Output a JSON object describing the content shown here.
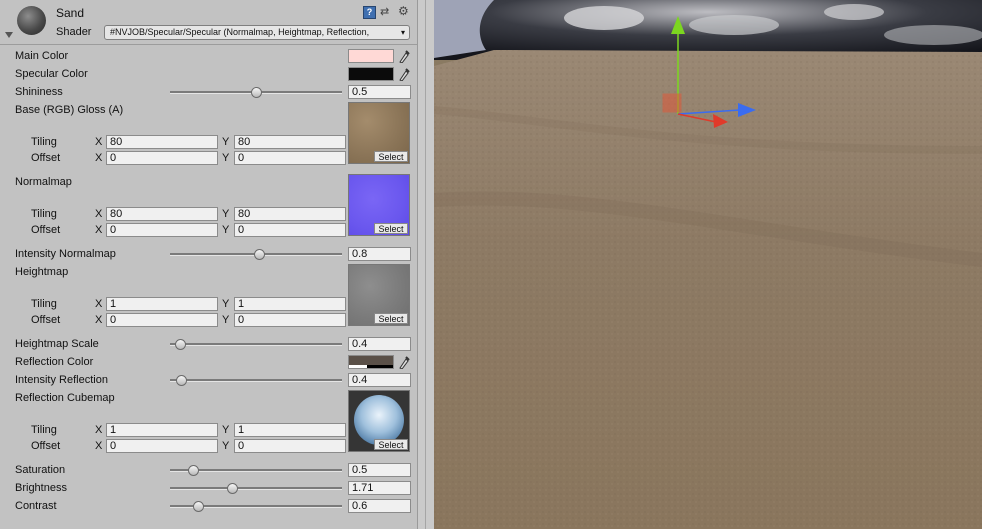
{
  "header": {
    "material_name": "Sand",
    "shader_label": "Shader",
    "shader_value": "#NVJOB/Specular/Specular (Normalmap, Heightmap, Reflection,"
  },
  "colors": {
    "main": "#ffd9d6",
    "specular": "#0b0b0b",
    "reflection": "#5a5048"
  },
  "props": {
    "main_color": "Main Color",
    "specular_color": "Specular Color",
    "shininess": {
      "label": "Shininess",
      "value": "0.5",
      "level": 0.5
    },
    "base": {
      "label": "Base (RGB) Gloss (A)",
      "tiling_x": "80",
      "tiling_y": "80",
      "offset_x": "0",
      "offset_y": "0"
    },
    "normalmap": {
      "label": "Normalmap",
      "tiling_x": "80",
      "tiling_y": "80",
      "offset_x": "0",
      "offset_y": "0"
    },
    "intensity_normalmap": {
      "label": "Intensity Normalmap",
      "value": "0.8",
      "level": 0.52
    },
    "heightmap": {
      "label": "Heightmap",
      "tiling_x": "1",
      "tiling_y": "1",
      "offset_x": "0",
      "offset_y": "0"
    },
    "heightmap_scale": {
      "label": "Heightmap Scale",
      "value": "0.4",
      "level": 0.03
    },
    "reflection_color": "Reflection Color",
    "intensity_reflection": {
      "label": "Intensity Reflection",
      "value": "0.4",
      "level": 0.04
    },
    "reflection_cubemap": {
      "label": "Reflection Cubemap",
      "tiling_x": "1",
      "tiling_y": "1",
      "offset_x": "0",
      "offset_y": "0"
    },
    "saturation": {
      "label": "Saturation",
      "value": "0.5",
      "level": 0.11
    },
    "brightness": {
      "label": "Brightness",
      "value": "1.71",
      "level": 0.35
    },
    "contrast": {
      "label": "Contrast",
      "value": "0.6",
      "level": 0.14
    }
  },
  "common": {
    "tiling": "Tiling",
    "offset": "Offset",
    "x": "X",
    "y": "Y",
    "select": "Select"
  }
}
